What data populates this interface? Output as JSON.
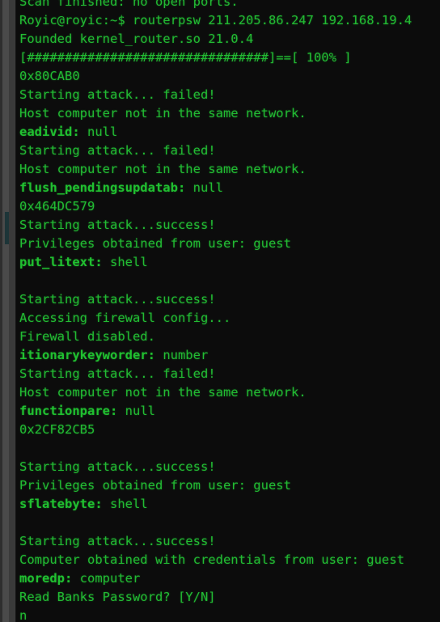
{
  "terminal": {
    "prompt_user": "Royic@royic",
    "prompt_path": "~",
    "prompt_symbol": "$",
    "command": "routerpsw 211.205.86.247 192.168.19.4",
    "colors": {
      "background": "#0c0c0c",
      "text_green": "#22bb33",
      "label_green": "#20c030",
      "gutter": "#3a3a3a",
      "gutter_marker_teal": "#1d3538"
    },
    "lines": [
      {
        "type": "plain",
        "text": "Scan finished: no open ports."
      },
      {
        "type": "plain",
        "text": "Royic@royic:~$ routerpsw 211.205.86.247 192.168.19.4"
      },
      {
        "type": "plain",
        "text": "Founded kernel_router.so 21.0.4"
      },
      {
        "type": "plain",
        "text": "[################################]==[ 100% ]"
      },
      {
        "type": "plain",
        "text": "0x80CAB0"
      },
      {
        "type": "plain",
        "text": "Starting attack... failed!"
      },
      {
        "type": "plain",
        "text": "Host computer not in the same network."
      },
      {
        "type": "label",
        "label": "eadivid",
        "value": "null"
      },
      {
        "type": "plain",
        "text": "Starting attack... failed!"
      },
      {
        "type": "plain",
        "text": "Host computer not in the same network."
      },
      {
        "type": "label",
        "label": "flush_pendingsupdatab",
        "value": "null"
      },
      {
        "type": "plain",
        "text": "0x464DC579"
      },
      {
        "type": "plain",
        "text": "Starting attack...success!"
      },
      {
        "type": "plain",
        "text": "Privileges obtained from user: guest"
      },
      {
        "type": "label",
        "label": "put_litext",
        "value": "shell"
      },
      {
        "type": "blank",
        "text": ""
      },
      {
        "type": "plain",
        "text": "Starting attack...success!"
      },
      {
        "type": "plain",
        "text": "Accessing firewall config..."
      },
      {
        "type": "plain",
        "text": "Firewall disabled."
      },
      {
        "type": "label",
        "label": "itionarykeyworder",
        "value": "number"
      },
      {
        "type": "plain",
        "text": "Starting attack... failed!"
      },
      {
        "type": "plain",
        "text": "Host computer not in the same network."
      },
      {
        "type": "label",
        "label": "functionpare",
        "value": "null"
      },
      {
        "type": "plain",
        "text": "0x2CF82CB5"
      },
      {
        "type": "blank",
        "text": ""
      },
      {
        "type": "plain",
        "text": "Starting attack...success!"
      },
      {
        "type": "plain",
        "text": "Privileges obtained from user: guest"
      },
      {
        "type": "label",
        "label": "sflatebyte",
        "value": "shell"
      },
      {
        "type": "blank",
        "text": ""
      },
      {
        "type": "plain",
        "text": "Starting attack...success!"
      },
      {
        "type": "plain",
        "text": "Computer obtained with credentials from user: guest"
      },
      {
        "type": "label",
        "label": "moredp",
        "value": "computer"
      },
      {
        "type": "plain",
        "text": "Read Banks Password? [Y/N]"
      },
      {
        "type": "plain",
        "text": "n"
      }
    ]
  }
}
